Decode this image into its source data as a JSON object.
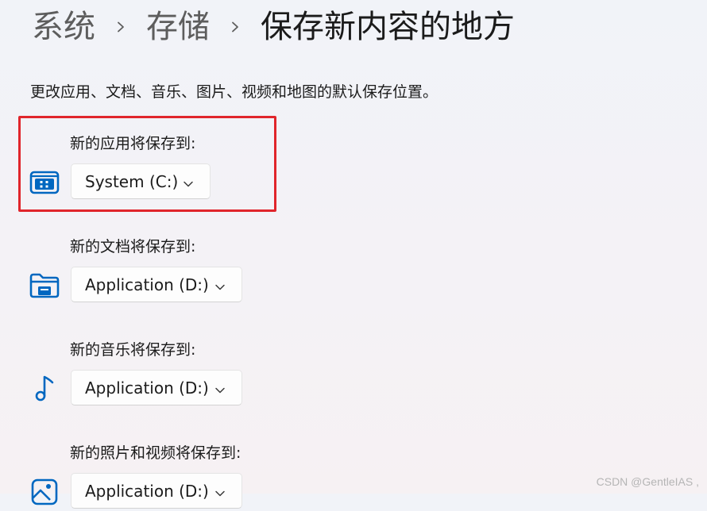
{
  "breadcrumb": {
    "items": [
      "系统",
      "存储"
    ],
    "current": "保存新内容的地方"
  },
  "description": "更改应用、文档、音乐、图片、视频和地图的默认保存位置。",
  "settings": [
    {
      "label": "新的应用将保存到:",
      "value": "System (C:)",
      "icon": "apps-icon"
    },
    {
      "label": "新的文档将保存到:",
      "value": "Application (D:)",
      "icon": "folder-icon"
    },
    {
      "label": "新的音乐将保存到:",
      "value": "Application (D:)",
      "icon": "music-note-icon"
    },
    {
      "label": "新的照片和视频将保存到:",
      "value": "Application (D:)",
      "icon": "photo-icon"
    }
  ],
  "colors": {
    "accent": "#0067c0",
    "highlight": "#e0252b"
  },
  "watermark": "CSDN @GentleIAS ,"
}
